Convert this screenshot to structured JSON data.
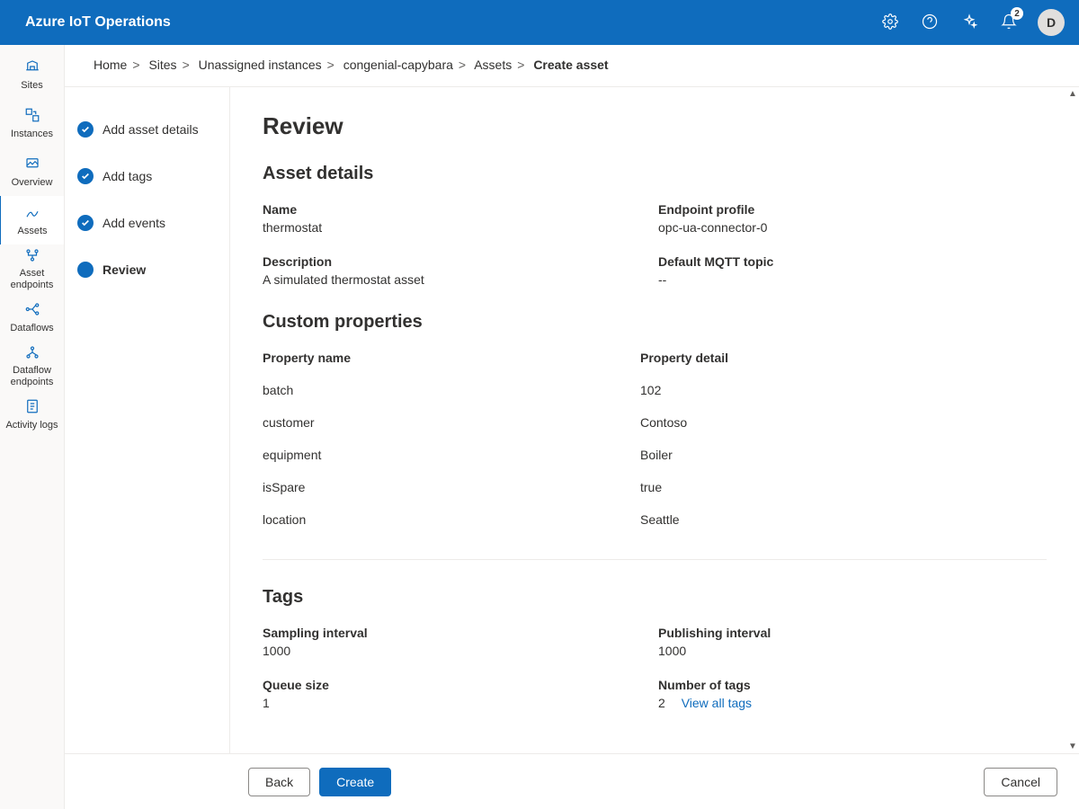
{
  "header": {
    "brand": "Azure IoT Operations",
    "notification_badge": "2",
    "avatar_initial": "D"
  },
  "leftnav": {
    "items": [
      {
        "id": "sites",
        "label": "Sites"
      },
      {
        "id": "instances",
        "label": "Instances"
      },
      {
        "id": "overview",
        "label": "Overview"
      },
      {
        "id": "assets",
        "label": "Assets",
        "active": true
      },
      {
        "id": "asset-endpoints",
        "label": "Asset endpoints"
      },
      {
        "id": "dataflows",
        "label": "Dataflows"
      },
      {
        "id": "dataflow-endpoints",
        "label": "Dataflow endpoints"
      },
      {
        "id": "activity-logs",
        "label": "Activity logs"
      }
    ]
  },
  "breadcrumb": {
    "items": [
      "Home",
      "Sites",
      "Unassigned instances",
      "congenial-capybara",
      "Assets"
    ],
    "current": "Create asset"
  },
  "wizard": {
    "steps": [
      {
        "label": "Add asset details",
        "state": "complete"
      },
      {
        "label": "Add tags",
        "state": "complete"
      },
      {
        "label": "Add events",
        "state": "complete"
      },
      {
        "label": "Review",
        "state": "current"
      }
    ]
  },
  "review": {
    "title": "Review",
    "asset_details": {
      "heading": "Asset details",
      "name_label": "Name",
      "name_value": "thermostat",
      "endpoint_label": "Endpoint profile",
      "endpoint_value": "opc-ua-connector-0",
      "description_label": "Description",
      "description_value": "A simulated thermostat asset",
      "mqtt_label": "Default MQTT topic",
      "mqtt_value": "--"
    },
    "custom_props": {
      "heading": "Custom properties",
      "col_name": "Property name",
      "col_detail": "Property detail",
      "rows": [
        {
          "name": "batch",
          "detail": "102"
        },
        {
          "name": "customer",
          "detail": "Contoso"
        },
        {
          "name": "equipment",
          "detail": "Boiler"
        },
        {
          "name": "isSpare",
          "detail": "true"
        },
        {
          "name": "location",
          "detail": "Seattle"
        }
      ]
    },
    "tags": {
      "heading": "Tags",
      "sampling_label": "Sampling interval",
      "sampling_value": "1000",
      "publishing_label": "Publishing interval",
      "publishing_value": "1000",
      "queue_label": "Queue size",
      "queue_value": "1",
      "count_label": "Number of tags",
      "count_value": "2",
      "view_all": "View all tags"
    }
  },
  "footer": {
    "back": "Back",
    "create": "Create",
    "cancel": "Cancel"
  }
}
